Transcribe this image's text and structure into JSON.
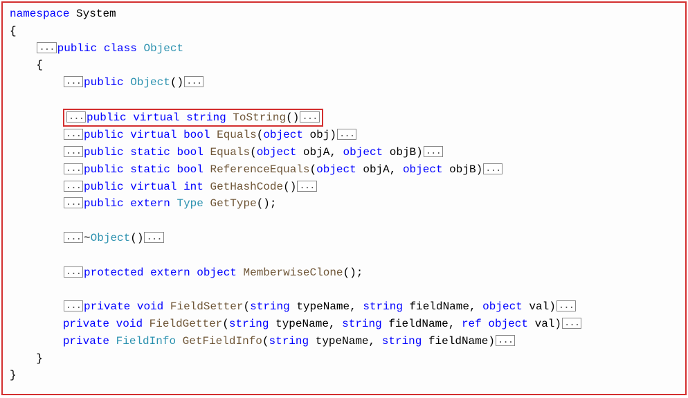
{
  "ns_keyword": "namespace",
  "ns_name": "System",
  "open_brace": "{",
  "close_brace": "}",
  "fold": "...",
  "class_decl": {
    "mod": "public",
    "kw": "class",
    "name": "Object"
  },
  "ctor": {
    "mod": "public",
    "name": "Object",
    "sig": "()"
  },
  "tostring": {
    "mod": "public",
    "virt": "virtual",
    "ret": "string",
    "name": "ToString",
    "sig": "()"
  },
  "equals1": {
    "mod": "public",
    "virt": "virtual",
    "ret": "bool",
    "name": "Equals",
    "sig_open": "(",
    "ptype": "object",
    "pname": " obj)",
    "after": ""
  },
  "equals2": {
    "mod": "public",
    "stat": "static",
    "ret": "bool",
    "name": "Equals",
    "open": "(",
    "p1t": "object",
    "p1n": " objA, ",
    "p2t": "object",
    "p2n": " objB)"
  },
  "refeq": {
    "mod": "public",
    "stat": "static",
    "ret": "bool",
    "name": "ReferenceEquals",
    "open": "(",
    "p1t": "object",
    "p1n": " objA, ",
    "p2t": "object",
    "p2n": " objB)"
  },
  "hash": {
    "mod": "public",
    "virt": "virtual",
    "ret": "int",
    "name": "GetHashCode",
    "sig": "()"
  },
  "gettype": {
    "mod": "public",
    "ext": "extern",
    "ret": "Type",
    "name": "GetType",
    "sig": "();"
  },
  "dtor": {
    "tilde": "~",
    "name": "Object",
    "sig": "()"
  },
  "mwc": {
    "mod": "protected",
    "ext": "extern",
    "ret": "object",
    "name": "MemberwiseClone",
    "sig": "();"
  },
  "fs": {
    "mod": "private",
    "ret": "void",
    "name": "FieldSetter",
    "open": "(",
    "t1": "string",
    "n1": " typeName, ",
    "t2": "string",
    "n2": " fieldName, ",
    "t3": "object",
    "n3": " val)"
  },
  "fg": {
    "mod": "private",
    "ret": "void",
    "name": "FieldGetter",
    "open": "(",
    "t1": "string",
    "n1": " typeName, ",
    "t2": "string",
    "n2": " fieldName, ",
    "refkw": "ref",
    "t3": " object",
    "n3": " val)"
  },
  "gfi": {
    "mod": "private",
    "ret": "FieldInfo",
    "name": "GetFieldInfo",
    "open": "(",
    "t1": "string",
    "n1": " typeName, ",
    "t2": "string",
    "n2": " fieldName)"
  }
}
